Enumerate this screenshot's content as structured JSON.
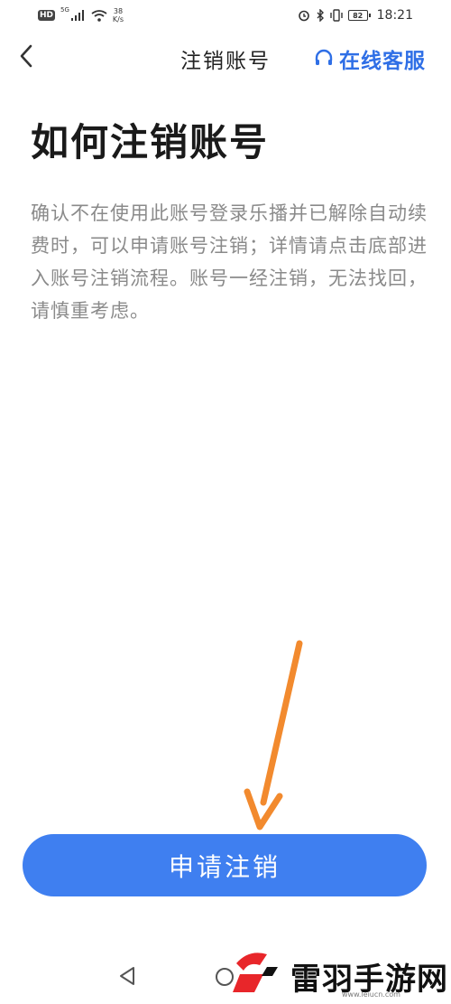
{
  "status_bar": {
    "hd": "HD",
    "network": "5G",
    "speed_value": "38",
    "speed_unit": "K/s",
    "battery": "82",
    "time": "18:21"
  },
  "nav": {
    "title": "注销账号",
    "support_label": "在线客服"
  },
  "main": {
    "heading": "如何注销账号",
    "description": "确认不在使用此账号登录乐播并已解除自动续费时，可以申请账号注销；详情请点击底部进入账号注销流程。账号一经注销，无法找回，请慎重考虑。"
  },
  "action": {
    "apply_label": "申请注销"
  },
  "watermark": {
    "name": "雷羽手游网",
    "url": "www.leiucn.com"
  },
  "colors": {
    "accent": "#3f7ff0",
    "support": "#2f6fe6",
    "arrow": "#f28a2e",
    "logo_red": "#e8262a"
  }
}
